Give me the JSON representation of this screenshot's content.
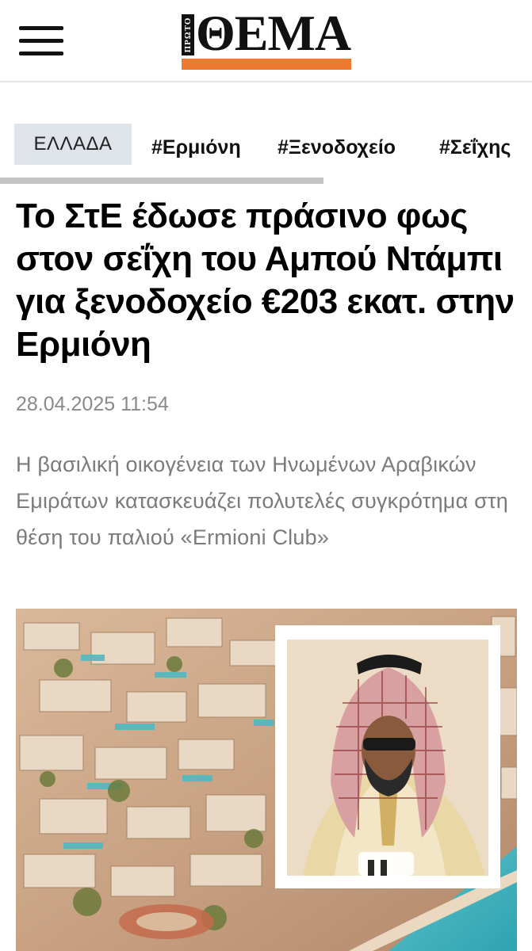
{
  "header": {
    "logo": {
      "proto_label": "ΠΡΩΤΟ",
      "wordmark": "ΘΕΜΑ",
      "accent_color": "#ee7a2f"
    },
    "menu_icon": "hamburger-menu-icon"
  },
  "tags": {
    "category": "ΕΛΛΑΔΑ",
    "items": [
      "#Ερμιόνη",
      "#Ξενοδοχείο",
      "#Σεΐχης"
    ]
  },
  "article": {
    "headline": "Το ΣτΕ έδωσε πράσινο φως στον σεΐχη του Αμπού Ντάμπι για ξενοδοχείο €203 εκατ. στην Ερμιόνη",
    "date": "28.04.2025 11:54",
    "lead": "Η βασιλική οικογένεια των Ηνωμένων Αραβικών Εμιράτων κατασκευάζει πολυτελές συγκρότημα στη θέση του παλιού «Ermioni Club»"
  }
}
